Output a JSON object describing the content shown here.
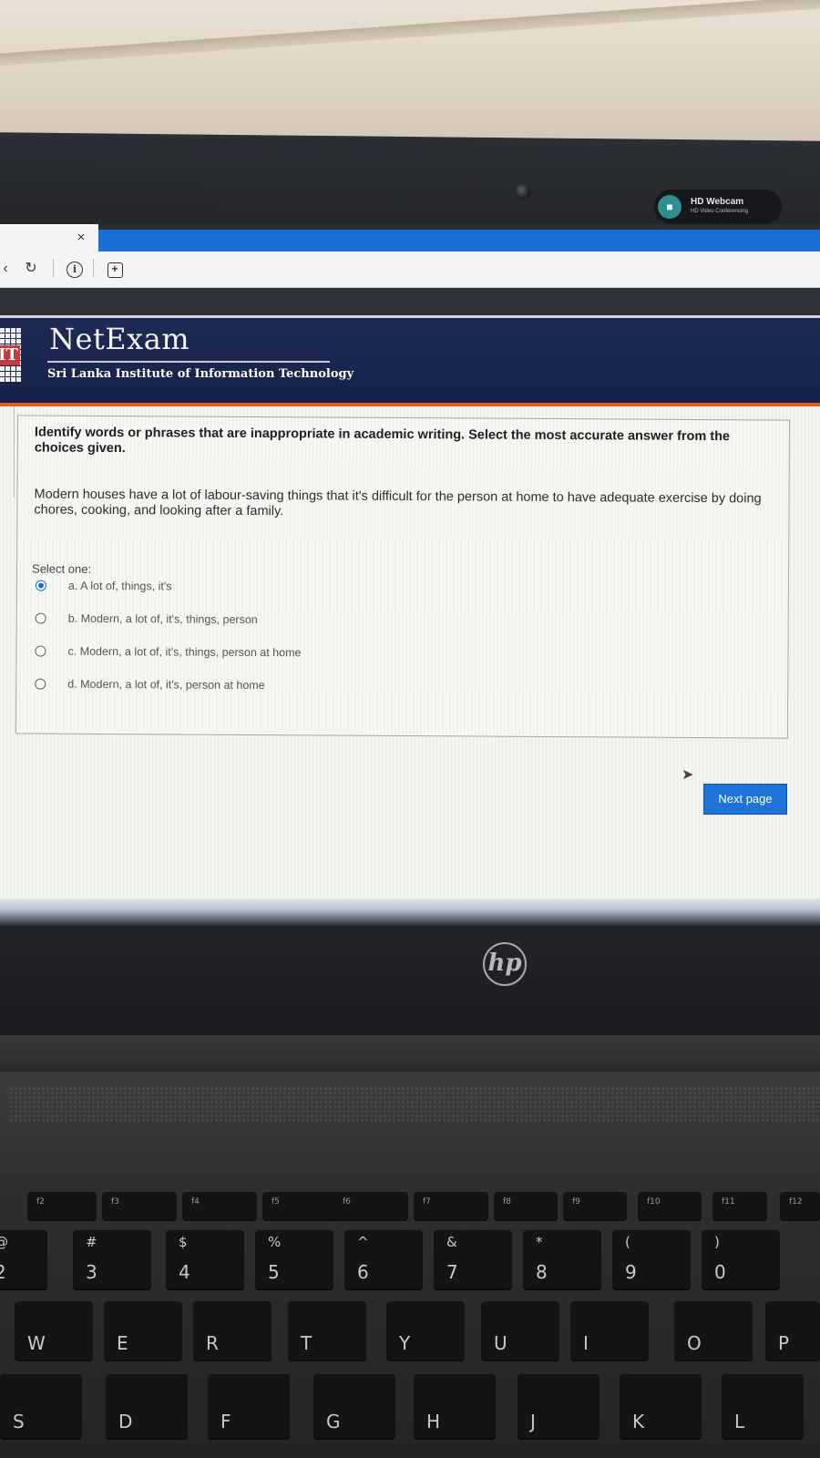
{
  "webcam": {
    "title": "HD Webcam",
    "subtitle": "HD Video Conferencing"
  },
  "browser": {
    "tab_close": "×",
    "reload_icon": "↻",
    "info_icon": "i",
    "save_icon": "+"
  },
  "site": {
    "brand": "NetExam",
    "tagline": "Sri Lanka Institute of Information Technology",
    "logo_text": "IT"
  },
  "question": {
    "prompt": "Identify words or phrases that are inappropriate in academic writing. Select the most accurate answer from the choices given.",
    "passage": "Modern houses have a lot of labour-saving things that it's difficult for the person at home to have adequate exercise by doing chores, cooking, and looking after a family.",
    "select_label": "Select one:",
    "options": [
      {
        "label": "a. A lot of, things, it's",
        "selected": true
      },
      {
        "label": "b. Modern, a lot of, it's, things, person",
        "selected": false
      },
      {
        "label": "c. Modern, a lot of, it's, things, person at home",
        "selected": false
      },
      {
        "label": "d. Modern, a lot of, it's, person at home",
        "selected": false
      }
    ]
  },
  "navigation": {
    "next_label": "Next page"
  },
  "laptop": {
    "brand": "hp"
  },
  "keyboard": {
    "fn_row": [
      "f2",
      "f3",
      "f4",
      "f5",
      "f6",
      "f7",
      "f8",
      "f9",
      "f10",
      "f11",
      "f12"
    ],
    "num_row": [
      {
        "top": "@",
        "main": "2"
      },
      {
        "top": "#",
        "main": "3"
      },
      {
        "top": "$",
        "main": "4"
      },
      {
        "top": "%",
        "main": "5"
      },
      {
        "top": "^",
        "main": "6"
      },
      {
        "top": "&",
        "main": "7"
      },
      {
        "top": "*",
        "main": "8"
      },
      {
        "top": "(",
        "main": "9"
      },
      {
        "top": ")",
        "main": "0"
      }
    ],
    "qwerty_row": [
      "W",
      "E",
      "R",
      "T",
      "Y",
      "U",
      "I",
      "O",
      "P"
    ],
    "home_row": [
      "S",
      "D",
      "F",
      "G",
      "H",
      "J",
      "K",
      "L"
    ]
  },
  "colors": {
    "header_bg": "#1d2a55",
    "header_accent": "#e25a2c",
    "button_bg": "#1e73d8",
    "browser_blue": "#1a6fd6"
  }
}
